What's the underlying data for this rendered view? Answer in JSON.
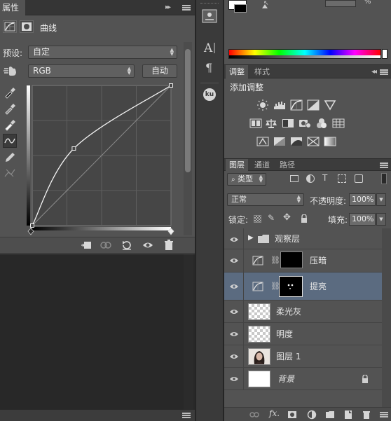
{
  "properties_panel": {
    "tab_label": "属性",
    "title": "曲线",
    "preset_label": "预设:",
    "preset_value": "自定",
    "channel_value": "RGB",
    "auto_button": "自动"
  },
  "adjustments_panel": {
    "tabs": [
      "调整",
      "样式"
    ],
    "heading": "添加调整"
  },
  "layers_panel": {
    "tabs": [
      "图层",
      "通道",
      "路径"
    ],
    "filter_kind": "类型",
    "blend_mode": "正常",
    "opacity_label": "不透明度:",
    "opacity_value": "100%",
    "lock_label": "锁定:",
    "fill_label": "填充:",
    "fill_value": "100%",
    "layers": [
      {
        "name": "观察层",
        "type": "group"
      },
      {
        "name": "压暗",
        "type": "curves-adjustment"
      },
      {
        "name": "提亮",
        "type": "curves-adjustment",
        "selected": true
      },
      {
        "name": "柔光灰",
        "type": "pixel"
      },
      {
        "name": "明度",
        "type": "pixel"
      },
      {
        "name": "图层 1",
        "type": "photo"
      },
      {
        "name": "背景",
        "type": "background",
        "locked": true
      }
    ]
  },
  "dock": {
    "ku_label": "ku"
  },
  "curve": {
    "points": [
      [
        0,
        0
      ],
      [
        0.3,
        0.55
      ],
      [
        1,
        1
      ]
    ]
  },
  "colors": {
    "panel_bg": "#535353",
    "selected_row": "#5b6b80",
    "dark_area": "#282828"
  }
}
